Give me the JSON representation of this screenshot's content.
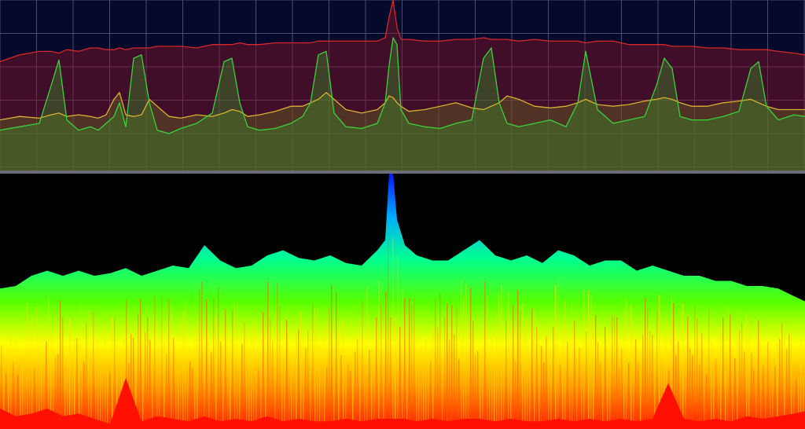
{
  "chart_data": [
    {
      "type": "line",
      "title": "",
      "xlabel": "",
      "ylabel": "",
      "grid": true,
      "legend": "none",
      "background": "#050a2c",
      "gridColor": "#4a4e6a",
      "xlim": [
        0,
        1024
      ],
      "ylim": [
        0,
        100
      ],
      "x": [
        0,
        25,
        50,
        65,
        75,
        85,
        100,
        115,
        125,
        135,
        145,
        152,
        160,
        170,
        180,
        190,
        200,
        215,
        230,
        250,
        270,
        285,
        295,
        305,
        315,
        330,
        350,
        370,
        385,
        395,
        405,
        415,
        425,
        440,
        460,
        480,
        490,
        495,
        500,
        505,
        510,
        520,
        540,
        560,
        580,
        600,
        615,
        625,
        635,
        645,
        660,
        680,
        700,
        720,
        735,
        745,
        760,
        780,
        800,
        820,
        835,
        845,
        855,
        865,
        880,
        900,
        920,
        940,
        955,
        965,
        975,
        990,
        1010,
        1024
      ],
      "series": [
        {
          "color": "#d42828",
          "fill": "rgba(140,20,40,0.45)",
          "values": [
            64,
            68,
            70,
            70,
            69,
            71,
            70,
            72,
            72,
            71,
            71,
            72,
            71,
            72,
            72,
            72,
            73,
            73,
            73,
            72,
            74,
            74,
            74,
            75,
            74,
            74,
            75,
            75,
            75,
            75,
            76,
            76,
            76,
            76,
            76,
            76,
            78,
            90,
            100,
            84,
            77,
            77,
            76,
            76,
            77,
            77,
            78,
            77,
            77,
            77,
            76,
            77,
            76,
            76,
            76,
            75,
            76,
            76,
            74,
            74,
            74,
            74,
            73,
            73,
            73,
            72,
            72,
            71,
            71,
            71,
            71,
            70,
            69,
            68
          ]
        },
        {
          "color": "#d8b030",
          "fill": "rgba(110,120,30,0.35)",
          "values": [
            30,
            32,
            31,
            33,
            34,
            32,
            33,
            32,
            31,
            33,
            42,
            46,
            33,
            32,
            33,
            42,
            38,
            32,
            31,
            33,
            32,
            34,
            36,
            35,
            32,
            33,
            35,
            38,
            38,
            40,
            42,
            46,
            42,
            36,
            34,
            36,
            40,
            44,
            43,
            40,
            38,
            35,
            36,
            38,
            40,
            37,
            36,
            38,
            40,
            44,
            42,
            38,
            37,
            38,
            40,
            42,
            39,
            38,
            39,
            41,
            42,
            43,
            42,
            40,
            38,
            38,
            40,
            41,
            42,
            40,
            38,
            36,
            36,
            36
          ]
        },
        {
          "color": "#3ad23a",
          "fill": "rgba(60,130,40,0.45)",
          "values": [
            24,
            26,
            28,
            50,
            65,
            30,
            24,
            26,
            24,
            28,
            32,
            40,
            26,
            66,
            68,
            40,
            24,
            22,
            25,
            28,
            34,
            64,
            66,
            40,
            26,
            24,
            25,
            28,
            32,
            40,
            68,
            70,
            34,
            26,
            25,
            28,
            40,
            62,
            78,
            74,
            36,
            28,
            26,
            25,
            28,
            30,
            66,
            72,
            40,
            28,
            26,
            28,
            30,
            26,
            40,
            70,
            36,
            28,
            30,
            32,
            50,
            66,
            60,
            32,
            30,
            30,
            32,
            35,
            60,
            64,
            38,
            30,
            33,
            32
          ]
        }
      ]
    },
    {
      "type": "area",
      "title": "",
      "xlabel": "",
      "ylabel": "",
      "grid": false,
      "legend": "none",
      "ylim": [
        0,
        100
      ],
      "colormap": [
        "#ff1400",
        "#ff9a00",
        "#ffff00",
        "#55ff00",
        "#00ff90",
        "#00aaff",
        "#0018ff"
      ],
      "x": [
        0,
        20,
        40,
        60,
        80,
        100,
        120,
        140,
        160,
        180,
        200,
        220,
        240,
        260,
        280,
        300,
        320,
        340,
        360,
        380,
        400,
        420,
        440,
        460,
        480,
        490,
        495,
        500,
        505,
        515,
        530,
        550,
        570,
        590,
        610,
        630,
        650,
        670,
        690,
        710,
        730,
        750,
        770,
        790,
        810,
        830,
        850,
        870,
        890,
        910,
        930,
        950,
        970,
        990,
        1010,
        1024
      ],
      "envelope": [
        55,
        56,
        60,
        62,
        60,
        62,
        60,
        61,
        63,
        60,
        62,
        64,
        63,
        72,
        66,
        63,
        64,
        68,
        70,
        67,
        66,
        68,
        65,
        64,
        70,
        74,
        100,
        100,
        82,
        72,
        68,
        66,
        66,
        70,
        74,
        68,
        66,
        68,
        65,
        70,
        68,
        64,
        66,
        66,
        62,
        64,
        62,
        60,
        60,
        58,
        58,
        56,
        56,
        55,
        52,
        50
      ],
      "baseline": [
        8,
        5,
        6,
        8,
        5,
        6,
        4,
        2,
        20,
        3,
        5,
        4,
        3,
        5,
        3,
        4,
        3,
        5,
        3,
        4,
        3,
        3,
        4,
        3,
        4,
        4,
        4,
        4,
        4,
        4,
        3,
        4,
        3,
        4,
        4,
        3,
        4,
        3,
        3,
        4,
        3,
        4,
        3,
        4,
        3,
        4,
        18,
        4,
        3,
        4,
        3,
        5,
        4,
        5,
        6,
        7
      ]
    }
  ]
}
